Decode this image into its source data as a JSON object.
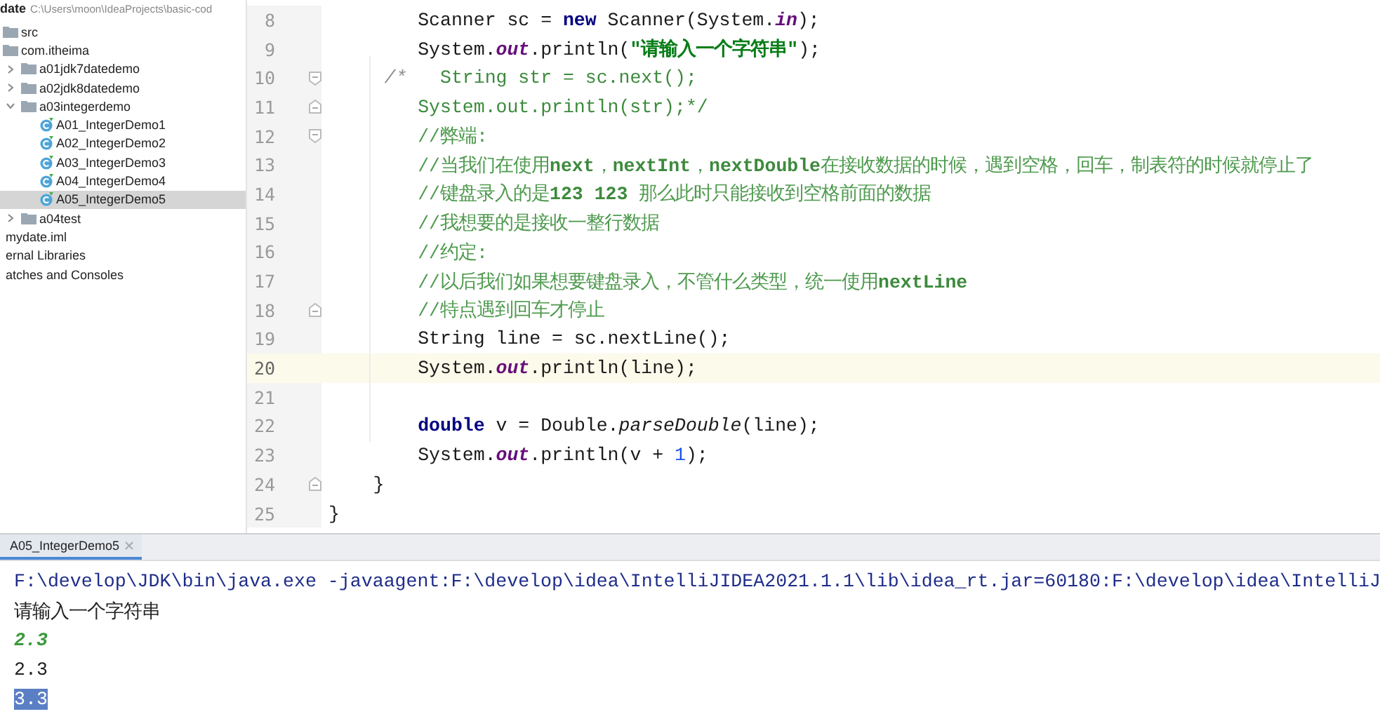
{
  "project_header": {
    "name": "date",
    "path": "C:\\Users\\moon\\IdeaProjects\\basic-cod"
  },
  "tree": [
    {
      "label": "src",
      "kind": "source",
      "selected": false
    },
    {
      "label": "com.itheima",
      "kind": "package",
      "selected": false,
      "children": [
        {
          "label": "a01jdk7datedemo",
          "kind": "package",
          "selected": false,
          "expanded": false
        },
        {
          "label": "a02jdk8datedemo",
          "kind": "package",
          "selected": false,
          "expanded": false
        },
        {
          "label": "a03integerdemo",
          "kind": "package",
          "selected": false,
          "expanded": true,
          "children": [
            {
              "label": "A01_IntegerDemo1",
              "kind": "class",
              "selected": false
            },
            {
              "label": "A02_IntegerDemo2",
              "kind": "class",
              "selected": false
            },
            {
              "label": "A03_IntegerDemo3",
              "kind": "class",
              "selected": false
            },
            {
              "label": "A04_IntegerDemo4",
              "kind": "class",
              "selected": false
            },
            {
              "label": "A05_IntegerDemo5",
              "kind": "class",
              "selected": true
            }
          ]
        },
        {
          "label": "a04test",
          "kind": "package",
          "selected": false,
          "expanded": false
        }
      ]
    },
    {
      "label": "mydate.iml",
      "kind": "text",
      "selected": false
    },
    {
      "label": "ernal Libraries",
      "kind": "text",
      "selected": false
    },
    {
      "label": "atches and Consoles",
      "kind": "text",
      "selected": false
    }
  ],
  "editor": {
    "lines": [
      {
        "number": "8",
        "current": false,
        "tokens": [
          {
            "t": "        Scanner sc = ",
            "kind": "plain"
          },
          {
            "t": "new",
            "kind": "keyword"
          },
          {
            "t": " Scanner(System.",
            "kind": "plain"
          },
          {
            "t": "in",
            "kind": "field"
          },
          {
            "t": ");",
            "kind": "plain"
          }
        ]
      },
      {
        "number": "9",
        "current": false,
        "tokens": [
          {
            "t": "        System.",
            "kind": "plain"
          },
          {
            "t": "out",
            "kind": "field"
          },
          {
            "t": ".println(",
            "kind": "plain"
          },
          {
            "t": "\"请输入一个字符串\"",
            "kind": "string"
          },
          {
            "t": ");",
            "kind": "plain"
          }
        ]
      },
      {
        "number": "10",
        "current": false,
        "fold_start": true,
        "tokens": [
          {
            "t": "     /*",
            "kind": "comment_mark"
          },
          {
            "t": "   String str = sc.next();",
            "kind": "block_comment"
          }
        ]
      },
      {
        "number": "11",
        "current": false,
        "fold_end": true,
        "tokens": [
          {
            "t": "        System.out.println(str);*/",
            "kind": "block_comment"
          }
        ]
      },
      {
        "number": "12",
        "current": false,
        "fold_start": true,
        "tokens": [
          {
            "t": "        //弊端:",
            "kind": "comment"
          }
        ]
      },
      {
        "number": "13",
        "current": false,
        "tokens": [
          {
            "t": "        //当我们在使用",
            "kind": "comment"
          },
          {
            "t": "next",
            "kind": "comment_bold"
          },
          {
            "t": "，",
            "kind": "comment"
          },
          {
            "t": "nextInt",
            "kind": "comment_bold"
          },
          {
            "t": "，",
            "kind": "comment"
          },
          {
            "t": "nextDouble",
            "kind": "comment_bold"
          },
          {
            "t": "在接收数据的时候，遇到空格，回车，制表符的时候就停止了",
            "kind": "comment"
          }
        ]
      },
      {
        "number": "14",
        "current": false,
        "tokens": [
          {
            "t": "        //键盘录入的是",
            "kind": "comment"
          },
          {
            "t": "123 123",
            "kind": "comment_bold"
          },
          {
            "t": " 那么此时只能接收到空格前面的数据",
            "kind": "comment"
          }
        ]
      },
      {
        "number": "15",
        "current": false,
        "tokens": [
          {
            "t": "        //我想要的是接收一整行数据",
            "kind": "comment"
          }
        ]
      },
      {
        "number": "16",
        "current": false,
        "tokens": [
          {
            "t": "        //约定:",
            "kind": "comment"
          }
        ]
      },
      {
        "number": "17",
        "current": false,
        "tokens": [
          {
            "t": "        //以后我们如果想要键盘录入，不管什么类型，统一使用",
            "kind": "comment"
          },
          {
            "t": "nextLine",
            "kind": "comment_bold"
          }
        ]
      },
      {
        "number": "18",
        "current": false,
        "fold_end": true,
        "tokens": [
          {
            "t": "        //特点遇到回车才停止",
            "kind": "comment"
          }
        ]
      },
      {
        "number": "19",
        "current": false,
        "tokens": [
          {
            "t": "        String line = sc.nextLine();",
            "kind": "plain"
          }
        ]
      },
      {
        "number": "20",
        "current": true,
        "tokens": [
          {
            "t": "        System.",
            "kind": "plain"
          },
          {
            "t": "out",
            "kind": "field"
          },
          {
            "t": ".println(line);",
            "kind": "plain"
          }
        ]
      },
      {
        "number": "21",
        "current": false
      },
      {
        "number": "22",
        "current": false,
        "tokens": [
          {
            "t": "        double",
            "kind": "keyword"
          },
          {
            "t": " v = Double.",
            "kind": "plain"
          },
          {
            "t": "parseDouble",
            "kind": "method"
          },
          {
            "t": "(line);",
            "kind": "plain"
          }
        ]
      },
      {
        "number": "23",
        "current": false,
        "tokens": [
          {
            "t": "        System.",
            "kind": "plain"
          },
          {
            "t": "out",
            "kind": "field"
          },
          {
            "t": ".println(v + ",
            "kind": "plain"
          },
          {
            "t": "1",
            "kind": "number"
          },
          {
            "t": ");",
            "kind": "plain"
          }
        ]
      },
      {
        "number": "24",
        "current": false,
        "fold_end": true,
        "tokens": [
          {
            "t": "    }",
            "kind": "plain"
          }
        ]
      },
      {
        "number": "25",
        "current": false,
        "tokens": [
          {
            "t": "}",
            "kind": "plain"
          }
        ]
      }
    ]
  },
  "run_panel": {
    "tabs": [
      {
        "label": "A05_IntegerDemo5",
        "selected": true
      }
    ],
    "console": [
      {
        "text": "F:\\develop\\JDK\\bin\\java.exe -javaagent:F:\\develop\\idea\\IntelliJIDEA2021.1.1\\lib\\idea_rt.jar=60180:F:\\develop\\idea\\IntelliJ",
        "kind": "command",
        "selected": false
      },
      {
        "text": "请输入一个字符串",
        "kind": "output",
        "selected": false
      },
      {
        "text": "2.3",
        "kind": "input",
        "selected": false
      },
      {
        "text": "2.3",
        "kind": "output",
        "selected": false
      },
      {
        "text": "3.3",
        "kind": "output",
        "selected": true
      }
    ]
  }
}
